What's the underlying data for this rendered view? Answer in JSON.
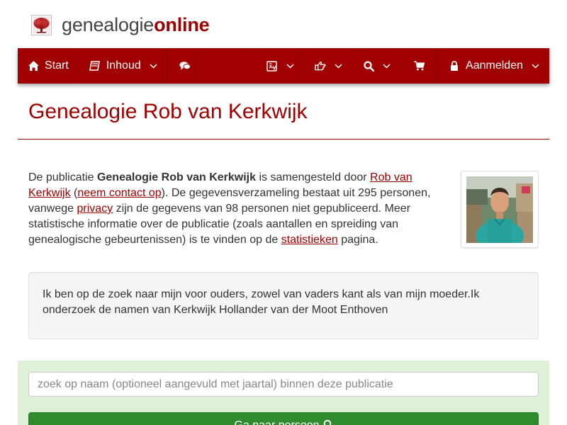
{
  "brand": {
    "name_part1": "genealogie",
    "name_part2": "online"
  },
  "nav": {
    "start": "Start",
    "inhoud": "Inhoud",
    "aanmelden": "Aanmelden",
    "icons": [
      "home-icon",
      "book-icon",
      "comments-icon",
      "translate-icon",
      "hand-point-icon",
      "search-icon",
      "cart-icon",
      "lock-icon"
    ]
  },
  "page": {
    "title": "Genealogie Rob van Kerkwijk"
  },
  "intro": {
    "t1": "De publicatie ",
    "pub_name": "Genealogie Rob van Kerkwijk",
    "t2": " is samengesteld door ",
    "author": "Rob van Kerkwijk",
    "t3": " (",
    "contact": "neem contact op",
    "t4": "). De gegevensverzameling bestaat uit 295 personen, vanwege ",
    "privacy": "privacy",
    "t5": " zijn de gegevens van 98 personen niet gepubliceerd. Meer statistische informatie over de publicatie (zoals aantallen en spreiding van genealogische gebeurtenissen) is te vinden op de ",
    "stats": "statistieken",
    "t6": " pagina."
  },
  "well": {
    "text": "Ik ben op de zoek naar mijn voor ouders, zowel van vaders kant als van mijn moeder.Ik onderzoek de namen van Kerkwijk Hollander van der Moot Enthoven"
  },
  "search": {
    "placeholder": "zoek op naam (optioneel aangevuld met jaartal) binnen deze publicatie",
    "button": "Ga naar persoon"
  },
  "colors": {
    "brand": "#a00000",
    "panel_green": "#dff0d8",
    "button_green": "#2e8b2e"
  }
}
